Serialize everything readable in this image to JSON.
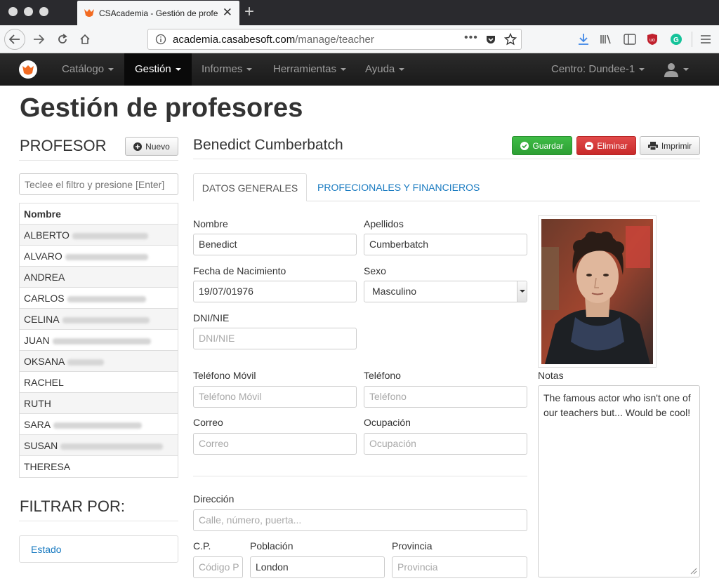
{
  "browser": {
    "tab_title": "CSAcademia - Gestión de profe",
    "url_host": "academia.casabesoft.com",
    "url_path": "/manage/teacher",
    "more_label": "•••"
  },
  "nav": {
    "items": [
      {
        "label": "Catálogo"
      },
      {
        "label": "Gestión"
      },
      {
        "label": "Informes"
      },
      {
        "label": "Herramientas"
      },
      {
        "label": "Ayuda"
      }
    ],
    "center": "Centro: Dundee-1"
  },
  "page": {
    "title": "Gestión de profesores"
  },
  "sidebar": {
    "section_title": "PROFESOR",
    "new_button": "Nuevo",
    "filter_placeholder": "Teclee el filtro y presione [Enter]",
    "column_header": "Nombre",
    "teachers": [
      {
        "name": "ALBERTO",
        "blur_w": 108
      },
      {
        "name": "ALVARO",
        "blur_w": 118
      },
      {
        "name": "ANDREA",
        "blur_w": 0
      },
      {
        "name": "CARLOS",
        "blur_w": 112
      },
      {
        "name": "CELINA",
        "blur_w": 124
      },
      {
        "name": "JUAN",
        "blur_w": 140
      },
      {
        "name": "OKSANA",
        "blur_w": 52
      },
      {
        "name": "RACHEL",
        "blur_w": 0
      },
      {
        "name": "RUTH",
        "blur_w": 0
      },
      {
        "name": "SARA",
        "blur_w": 126
      },
      {
        "name": "SUSAN",
        "blur_w": 146
      },
      {
        "name": "THERESA",
        "blur_w": 0
      }
    ],
    "filter_title": "FILTRAR POR:",
    "filter_item": "Estado"
  },
  "detail": {
    "name": "Benedict Cumberbatch",
    "save_button": "Guardar",
    "delete_button": "Eliminar",
    "print_button": "Imprimir",
    "tabs": [
      "DATOS GENERALES",
      "PROFECIONALES Y FINANCIEROS"
    ],
    "fields": {
      "nombre_label": "Nombre",
      "nombre_value": "Benedict",
      "apellidos_label": "Apellidos",
      "apellidos_value": "Cumberbatch",
      "fecha_label": "Fecha de Nacimiento",
      "fecha_value": "19/07/01976",
      "sexo_label": "Sexo",
      "sexo_value": "Masculino",
      "dni_label": "DNI/NIE",
      "dni_placeholder": "DNI/NIE",
      "movil_label": "Teléfono Móvil",
      "movil_placeholder": "Teléfono Móvil",
      "telefono_label": "Teléfono",
      "telefono_placeholder": "Teléfono",
      "correo_label": "Correo",
      "correo_placeholder": "Correo",
      "ocupacion_label": "Ocupación",
      "ocupacion_placeholder": "Ocupación",
      "direccion_label": "Dirección",
      "direccion_placeholder": "Calle, número, puerta...",
      "cp_label": "C.P.",
      "cp_placeholder": "Código P",
      "poblacion_label": "Población",
      "poblacion_value": "London",
      "provincia_label": "Provincia",
      "provincia_placeholder": "Provincia",
      "notas_label": "Notas",
      "notas_value": "The famous actor who isn't one of our teachers but... Would be cool!"
    }
  },
  "colors": {
    "accent": "#1a7bc1",
    "success": "#2d9f34",
    "danger": "#c82a2a",
    "navbar": "#1f1f1f",
    "logo": "#f26b22"
  }
}
